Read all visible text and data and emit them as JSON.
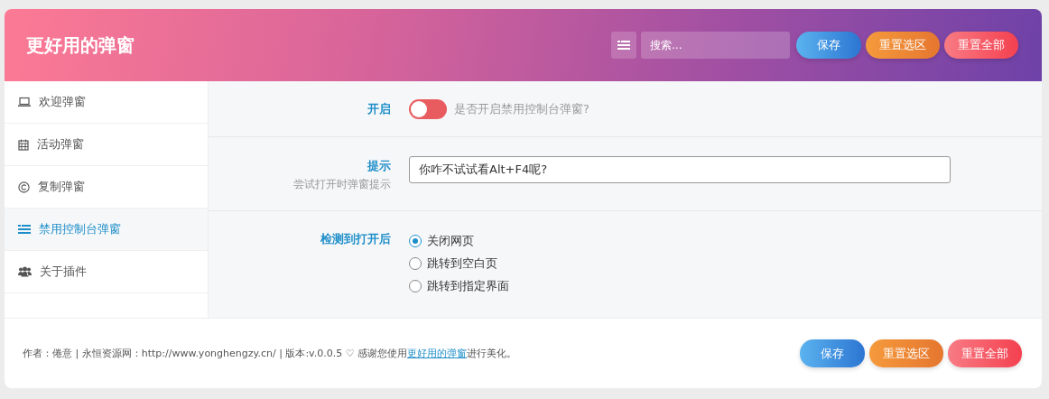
{
  "header": {
    "title": "更好用的弹窗",
    "search": {
      "placeholder": "搜索..."
    },
    "buttons": [
      {
        "label": "保存",
        "kind": "save"
      },
      {
        "label": "重置选区",
        "kind": "reset-section"
      },
      {
        "label": "重置全部",
        "kind": "reset-all"
      }
    ]
  },
  "sidebar": {
    "items": [
      {
        "label": "欢迎弹窗",
        "kind": "laptop",
        "selected": false
      },
      {
        "label": "活动弹窗",
        "kind": "calendar",
        "selected": false
      },
      {
        "label": "复制弹窗",
        "kind": "copyright",
        "selected": false
      },
      {
        "label": "禁用控制台弹窗",
        "kind": "list",
        "selected": true
      },
      {
        "label": "关于插件",
        "kind": "users",
        "selected": false
      }
    ]
  },
  "fields": [
    {
      "kind": "switch",
      "label": "开启",
      "on": false,
      "description": "是否开启禁用控制台弹窗?"
    },
    {
      "kind": "text",
      "label": "提示",
      "sublabel": "尝试打开时弹窗提示",
      "value": "你咋不试试看Alt+F4呢?"
    },
    {
      "kind": "radio",
      "label": "检测到打开后",
      "options": [
        {
          "label": "关闭网页",
          "selected": true
        },
        {
          "label": "跳转到空白页",
          "selected": false
        },
        {
          "label": "跳转到指定界面",
          "selected": false
        }
      ]
    }
  ],
  "footer": {
    "text_before": "作者：倦意 | 永恒资源网：http://www.yonghengzy.cn/ | 版本:v.0.0.5 ♡ 感谢您使用",
    "link": "更好用的弹窗",
    "text_after": "进行美化。",
    "buttons": [
      {
        "label": "保存",
        "kind": "save"
      },
      {
        "label": "重置选区",
        "kind": "reset-section"
      },
      {
        "label": "重置全部",
        "kind": "reset-all"
      }
    ]
  }
}
